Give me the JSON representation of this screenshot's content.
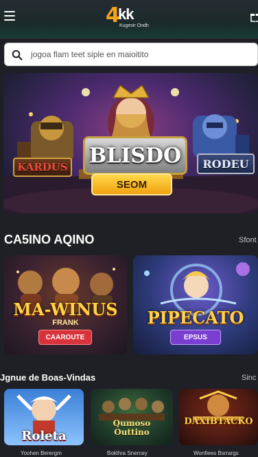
{
  "header": {
    "logo_mark": "4",
    "logo_text": "kk",
    "logo_sub": "Kugesir Ondh"
  },
  "search": {
    "placeholder": "jogoa flam teet siple en maioitito"
  },
  "hero": {
    "center_title": "BLISDO",
    "left_label": "KARDUS",
    "right_label": "RODEU",
    "button_label": "SEOM"
  },
  "section_casino": {
    "title": "CA5INO AQINO",
    "see_all": "Sfont",
    "cards": [
      {
        "title": "MA-WINUS",
        "subtitle": "FRANK",
        "button": "CAAROUTE"
      },
      {
        "title": "PIPECATO",
        "button": "EPSUS"
      }
    ]
  },
  "section_welcome": {
    "title": "Jgnue de Boas-Vindas",
    "see_all": "Sinc",
    "items": [
      {
        "title": "Roleta",
        "caption": "Yoohen Berergm"
      },
      {
        "title": "Qumoso\nOuttino",
        "caption": "Boklhra Snercey"
      },
      {
        "title": "DAXIBTACKO",
        "caption": "Wonfiees Bsrrargs"
      }
    ]
  },
  "colors": {
    "background": "#1e2026",
    "accent_gold": "#f6a21a",
    "button_red": "#d8333a",
    "button_purple": "#7a3fd1"
  }
}
